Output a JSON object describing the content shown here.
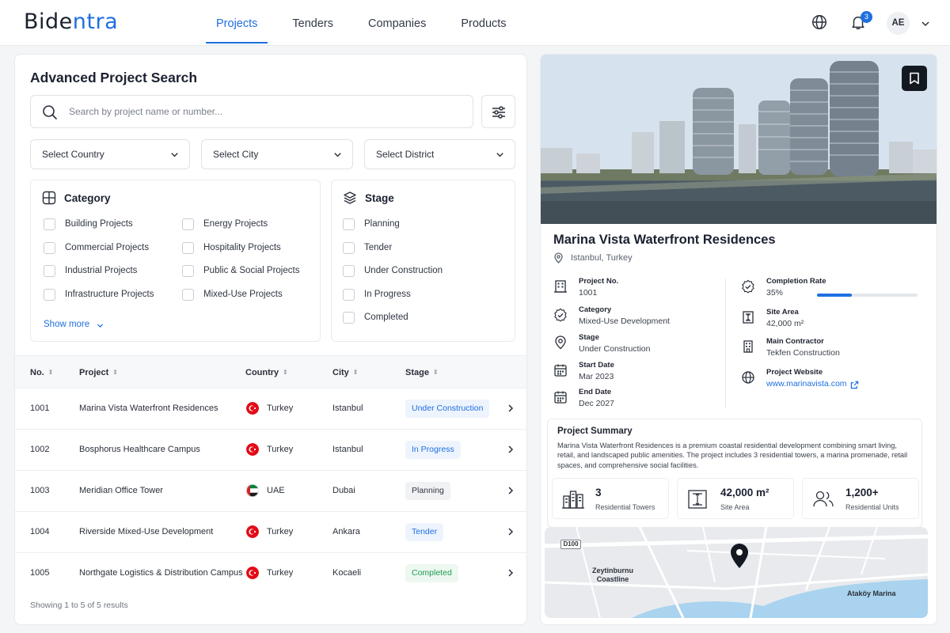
{
  "header": {
    "logo_part1": "Bide",
    "logo_part2": "ntra",
    "nav": [
      "Projects",
      "Tenders",
      "Companies",
      "Products"
    ],
    "active_nav": "Projects",
    "notification_count": "3",
    "avatar_initials": "AE"
  },
  "search_panel": {
    "title": "Advanced Project Search",
    "search_placeholder": "Search by project name or number...",
    "selects": {
      "country": "Select Country",
      "city": "Select City",
      "district": "Select District"
    },
    "category": {
      "title": "Category",
      "options": [
        "Building Projects",
        "Energy Projects",
        "Commercial Projects",
        "Hospitality Projects",
        "Industrial Projects",
        "Public & Social Projects",
        "Infrastructure Projects",
        "Mixed-Use Projects"
      ],
      "show_more": "Show more"
    },
    "stage": {
      "title": "Stage",
      "options": [
        "Planning",
        "Tender",
        "Under Construction",
        "In Progress",
        "Completed"
      ]
    }
  },
  "table": {
    "columns": [
      "No.",
      "Project",
      "Country",
      "City",
      "Stage"
    ],
    "rows": [
      {
        "no": "1001",
        "project": "Marina Vista Waterfront Residences",
        "country": "Turkey",
        "city": "Istanbul",
        "stage": "Under Construction"
      },
      {
        "no": "1002",
        "project": "Bosphorus Healthcare Campus",
        "country": "Turkey",
        "city": "Istanbul",
        "stage": "In Progress"
      },
      {
        "no": "1003",
        "project": "Meridian Office Tower",
        "country": "UAE",
        "city": "Dubai",
        "stage": "Planning"
      },
      {
        "no": "1004",
        "project": "Riverside Mixed-Use Development",
        "country": "Turkey",
        "city": "Ankara",
        "stage": "Tender"
      },
      {
        "no": "1005",
        "project": "Northgate Logistics & Distribution Campus",
        "country": "Turkey",
        "city": "Kocaeli",
        "stage": "Completed"
      }
    ],
    "footer": "Showing 1 to 5 of 5 results"
  },
  "detail": {
    "title": "Marina Vista Waterfront Residences",
    "location": "Istanbul, Turkey",
    "left_info": [
      {
        "label": "Project No.",
        "value": "1001",
        "icon": "building-icon"
      },
      {
        "label": "Category",
        "value": "Mixed-Use Development",
        "icon": "badge-icon"
      },
      {
        "label": "Stage",
        "value": "Under Construction",
        "icon": "location-pin-icon"
      },
      {
        "label": "Start Date",
        "value": "Mar 2023",
        "icon": "calendar-icon"
      },
      {
        "label": "End Date",
        "value": "Dec 2027",
        "icon": "calendar-icon"
      }
    ],
    "right_info": [
      {
        "label": "Completion Rate",
        "value": "35%",
        "icon": "verified-badge-icon"
      },
      {
        "label": "Site Area",
        "value": "42,000 m²",
        "icon": "area-icon"
      },
      {
        "label": "Main Contractor",
        "value": "Tekfen Construction",
        "icon": "office-building-icon"
      },
      {
        "label": "Project Website",
        "value": "www.marinavista.com",
        "icon": "globe-icon"
      }
    ],
    "completion_fraction": 0.35,
    "summary": {
      "title": "Project Summary",
      "text": "Marina Vista Waterfront Residences is a premium coastal residential development combining smart living, retail, and landscaped public amenities. The project includes 3 residential towers, a marina promenade, retail spaces, and comprehensive social facilities."
    },
    "stats": [
      {
        "value": "3",
        "label": "Residential Towers",
        "icon": "towers-icon"
      },
      {
        "value": "42,000 m²",
        "label": "Site Area",
        "icon": "area-frame-icon"
      },
      {
        "value": "1,200+",
        "label": "Residential Units",
        "icon": "users-icon"
      }
    ],
    "map": {
      "road": "D100",
      "place1": "Zeytinburnu\nCoastline",
      "place2": "Ataköy Marina"
    }
  },
  "colors": {
    "accent": "#1f6fe0",
    "stage_under_construction": "#1f6fe0",
    "stage_completed": "#1e9b4f",
    "stage_neutral": "#2f3542"
  }
}
